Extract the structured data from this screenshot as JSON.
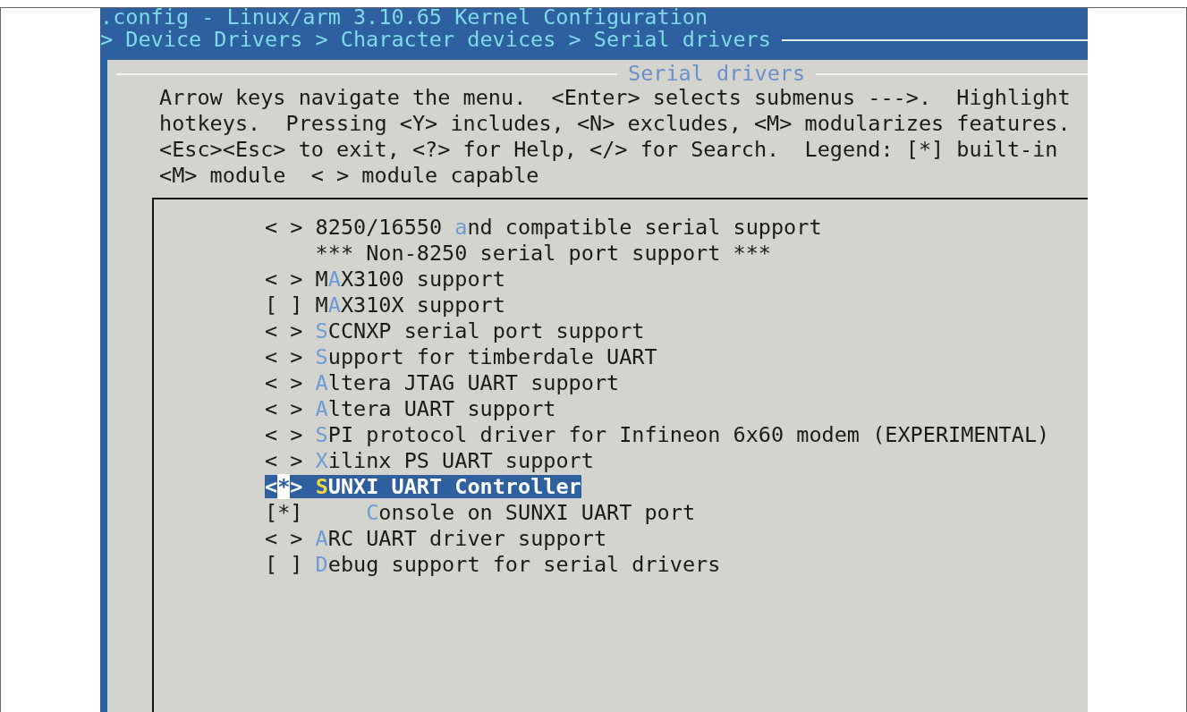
{
  "window": {
    "title": ".config - Linux/arm 3.10.65 Kernel Configuration"
  },
  "breadcrumb": "> Device Drivers > Character devices > Serial drivers",
  "dialog": {
    "title": "Serial drivers",
    "help_lines": [
      "Arrow keys navigate the menu.  <Enter> selects submenus --->.  Highlight",
      "hotkeys.  Pressing <Y> includes, <N> excludes, <M> modularizes features.",
      "<Esc><Esc> to exit, <?> for Help, </> for Search.  Legend: [*] built-in",
      "<M> module  < > module capable"
    ]
  },
  "menu": [
    {
      "kind": "option",
      "prefix": "< >",
      "before": "8250/16550 ",
      "hotkey": "a",
      "after": "nd compatible serial support",
      "selected": false
    },
    {
      "kind": "comment",
      "text": "*** Non-8250 serial port support ***",
      "selected": false
    },
    {
      "kind": "option",
      "prefix": "< >",
      "before": "M",
      "hotkey": "A",
      "after": "X3100 support",
      "selected": false
    },
    {
      "kind": "option",
      "prefix": "[ ]",
      "before": "M",
      "hotkey": "A",
      "after": "X310X support",
      "selected": false
    },
    {
      "kind": "option",
      "prefix": "< >",
      "hotkey": "S",
      "after": "CCNXP serial port support",
      "selected": false
    },
    {
      "kind": "option",
      "prefix": "< >",
      "hotkey": "S",
      "after": "upport for timberdale UART",
      "selected": false
    },
    {
      "kind": "option",
      "prefix": "< >",
      "hotkey": "A",
      "after": "ltera JTAG UART support",
      "selected": false
    },
    {
      "kind": "option",
      "prefix": "< >",
      "hotkey": "A",
      "after": "ltera UART support",
      "selected": false
    },
    {
      "kind": "option",
      "prefix": "< >",
      "hotkey": "S",
      "after": "PI protocol driver for Infineon 6x60 modem (EXPERIMENTAL)",
      "selected": false
    },
    {
      "kind": "option",
      "prefix": "< >",
      "hotkey": "X",
      "after": "ilinx PS UART support",
      "selected": false
    },
    {
      "kind": "option",
      "prefix": "<*>",
      "hotkey": "S",
      "after": "UNXI UART Controller",
      "selected": true,
      "children": [
        {
          "kind": "option",
          "prefix": "[*]",
          "hotkey": "C",
          "after": "onsole on SUNXI UART port",
          "selected": false
        }
      ]
    },
    {
      "kind": "option",
      "prefix": "< >",
      "hotkey": "A",
      "after": "RC UART driver support",
      "selected": false
    },
    {
      "kind": "option",
      "prefix": "[ ]",
      "hotkey": "D",
      "after": "ebug support for serial drivers",
      "selected": false
    }
  ]
}
